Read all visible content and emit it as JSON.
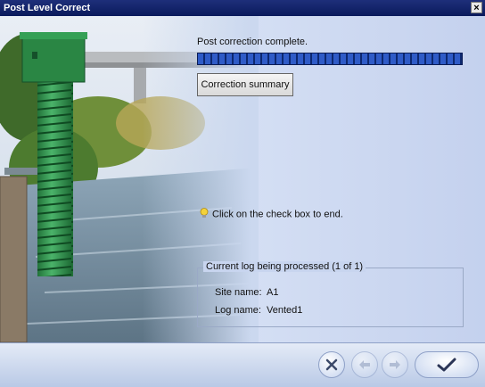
{
  "window": {
    "title": "Post Level Correct",
    "close_glyph": "×"
  },
  "status": {
    "message": "Post correction complete.",
    "progress": 1.0
  },
  "buttons": {
    "summary_label": "Correction summary"
  },
  "hint": {
    "text": "Click on the check box to end.",
    "icon": "lightbulb-icon"
  },
  "log_group": {
    "title": "Current log being processed (1 of 1)",
    "site_label": "Site name:",
    "site_value": "A1",
    "log_label": "Log name:",
    "log_value": "Vented1"
  },
  "footer": {
    "cancel_icon": "x-icon",
    "back_icon": "back-arrow-icon",
    "next_icon": "forward-arrow-icon",
    "ok_icon": "checkmark-icon"
  },
  "colors": {
    "progress": "#2f5bc7",
    "title_bar": "#0a1a5c",
    "pipe": "#2f8f4a"
  }
}
